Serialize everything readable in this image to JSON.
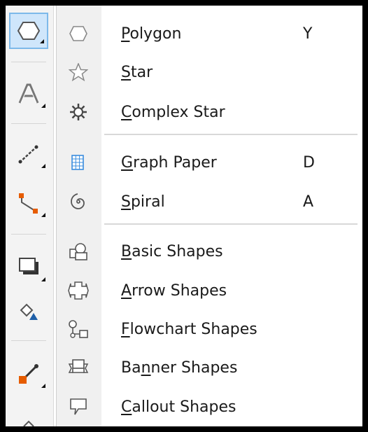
{
  "toolbar": {
    "tools": [
      {
        "name": "polygon-tool-icon",
        "active": true
      },
      {
        "name": "text-tool-icon"
      },
      {
        "name": "dimension-tool-icon"
      },
      {
        "name": "connector-tool-icon"
      },
      {
        "name": "drop-shadow-tool-icon"
      },
      {
        "name": "fill-tool-icon"
      },
      {
        "name": "eyedropper-tool-icon"
      }
    ]
  },
  "menu": {
    "items": [
      {
        "pre": "",
        "mn": "P",
        "post": "olygon",
        "shortcut": "Y",
        "icon": "polygon-icon"
      },
      {
        "pre": "",
        "mn": "S",
        "post": "tar",
        "shortcut": "",
        "icon": "star-icon"
      },
      {
        "pre": "",
        "mn": "C",
        "post": "omplex Star",
        "shortcut": "",
        "icon": "complex-star-icon"
      },
      {
        "pre": "",
        "mn": "G",
        "post": "raph Paper",
        "shortcut": "D",
        "icon": "graph-paper-icon"
      },
      {
        "pre": "",
        "mn": "S",
        "post": "piral",
        "shortcut": "A",
        "icon": "spiral-icon"
      },
      {
        "pre": "",
        "mn": "B",
        "post": "asic Shapes",
        "shortcut": "",
        "icon": "basic-shapes-icon"
      },
      {
        "pre": "",
        "mn": "A",
        "post": "rrow Shapes",
        "shortcut": "",
        "icon": "arrow-shapes-icon"
      },
      {
        "pre": "",
        "mn": "F",
        "post": "lowchart Shapes",
        "shortcut": "",
        "icon": "flowchart-shapes-icon"
      },
      {
        "pre": "Ba",
        "mn": "n",
        "post": "ner Shapes",
        "shortcut": "",
        "icon": "banner-shapes-icon"
      },
      {
        "pre": "",
        "mn": "C",
        "post": "allout Shapes",
        "shortcut": "",
        "icon": "callout-shapes-icon"
      }
    ]
  }
}
